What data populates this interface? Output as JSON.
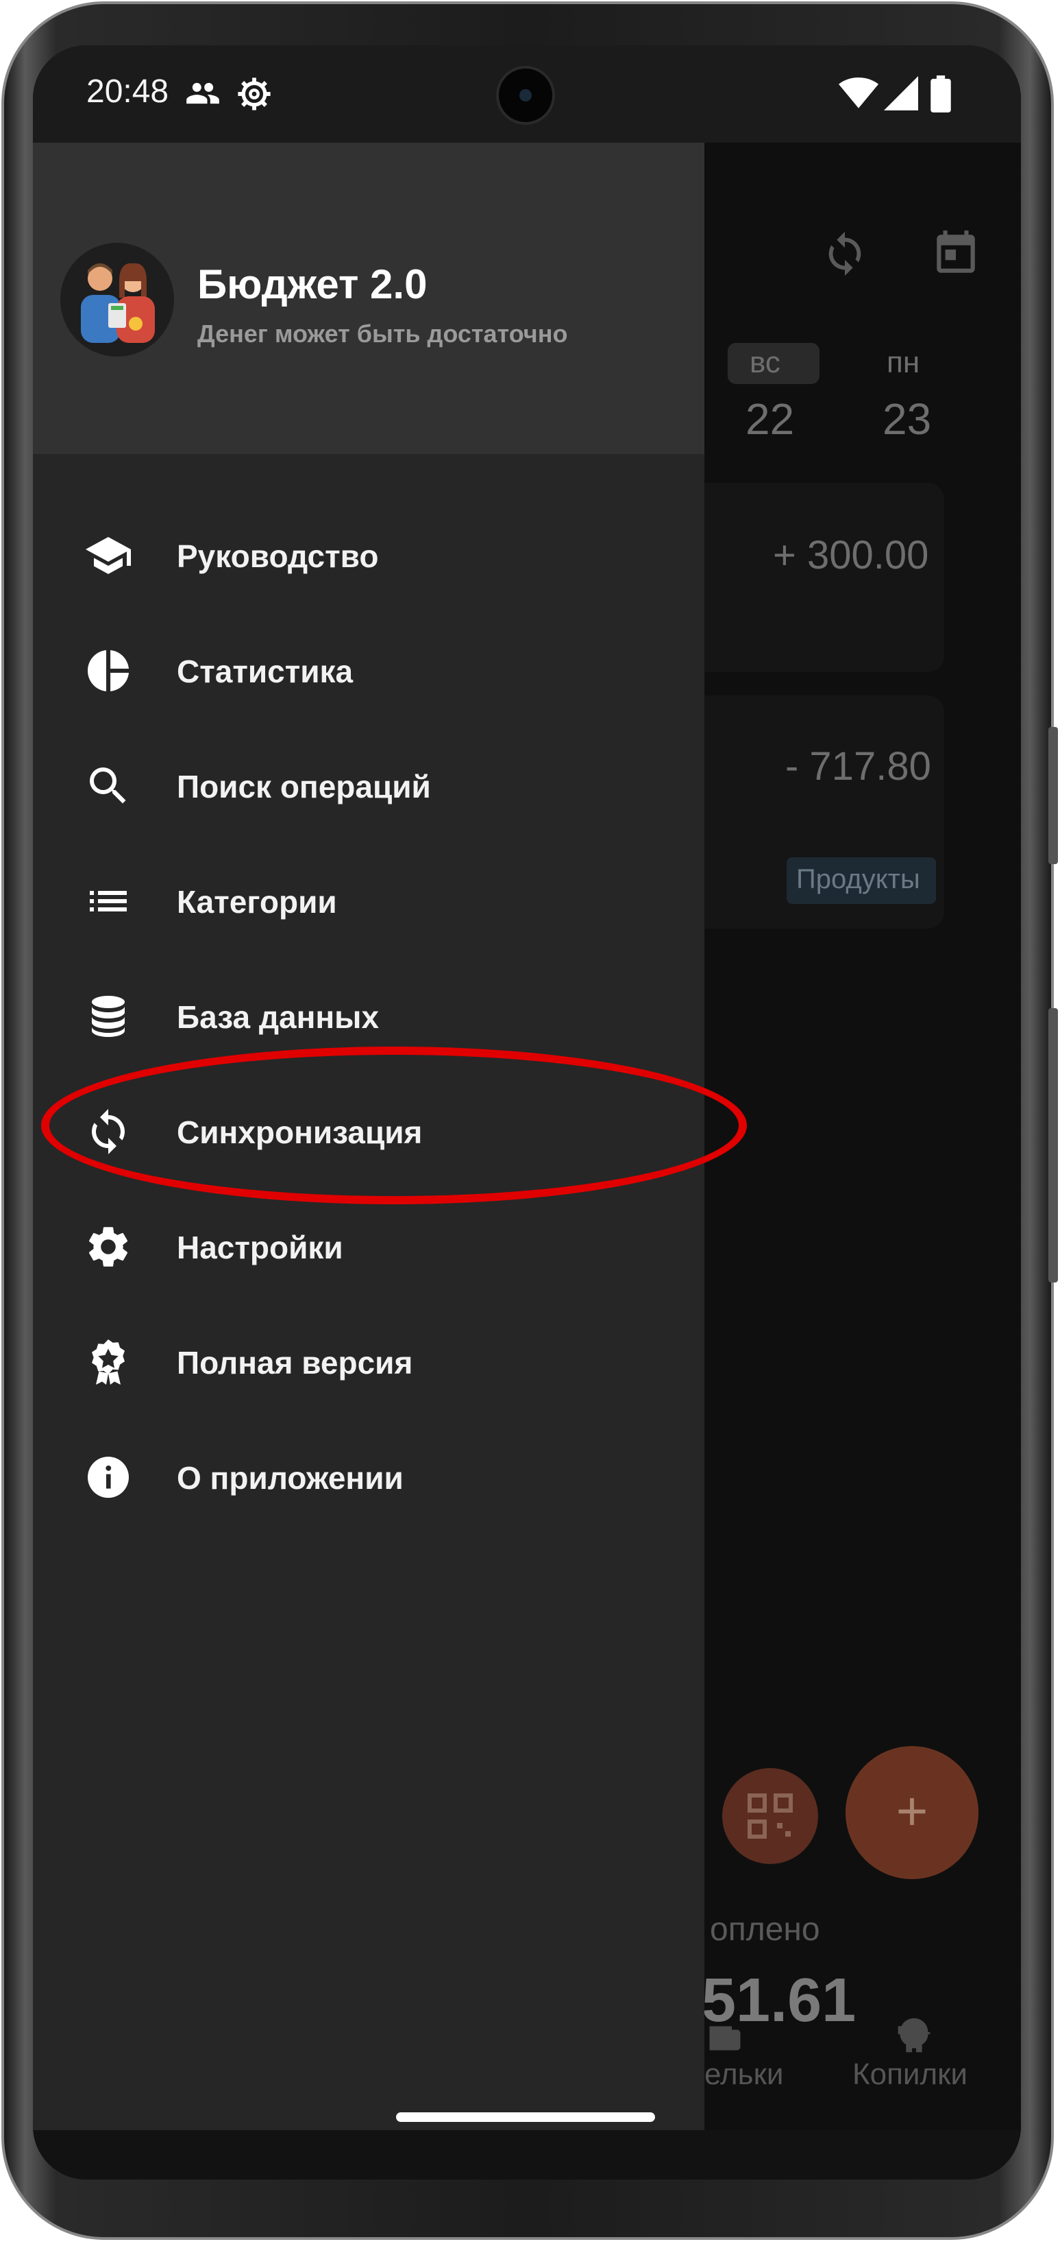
{
  "status_bar": {
    "time": "20:48",
    "icons": [
      "people-icon",
      "gear-icon",
      "wifi-icon",
      "signal-icon",
      "battery-icon"
    ]
  },
  "background_app": {
    "toolbar_icons": [
      "sync-icon",
      "calendar-icon"
    ],
    "days": [
      {
        "weekday": "вс",
        "date": "22",
        "selected": true
      },
      {
        "weekday": "пн",
        "date": "23",
        "selected": false
      }
    ],
    "transactions": [
      {
        "amount": "+ 300.00"
      },
      {
        "amount": "- 717.80",
        "category": "Продукты"
      }
    ],
    "balance_label_partial": "оплено",
    "balance_value_partial": "51.61",
    "bottom_nav": [
      {
        "label": "ельки",
        "icon": "wallet-icon"
      },
      {
        "label": "Копилки",
        "icon": "piggy-bank-icon"
      }
    ],
    "fab_add": "+"
  },
  "drawer": {
    "title": "Бюджет 2.0",
    "subtitle": "Денег может быть достаточно",
    "items": [
      {
        "label": "Руководство",
        "icon": "graduation-cap-icon"
      },
      {
        "label": "Статистика",
        "icon": "pie-chart-icon"
      },
      {
        "label": "Поиск операций",
        "icon": "search-icon"
      },
      {
        "label": "Категории",
        "icon": "list-icon"
      },
      {
        "label": "База данных",
        "icon": "database-icon"
      },
      {
        "label": "Синхронизация",
        "icon": "sync-icon",
        "highlighted": true
      },
      {
        "label": "Настройки",
        "icon": "settings-icon"
      },
      {
        "label": "Полная версия",
        "icon": "award-icon"
      },
      {
        "label": "О приложении",
        "icon": "info-icon"
      }
    ]
  },
  "colors": {
    "drawer_bg": "#262626",
    "header_bg": "#323232",
    "highlight": "#e00000",
    "fab": "#6a3321"
  }
}
